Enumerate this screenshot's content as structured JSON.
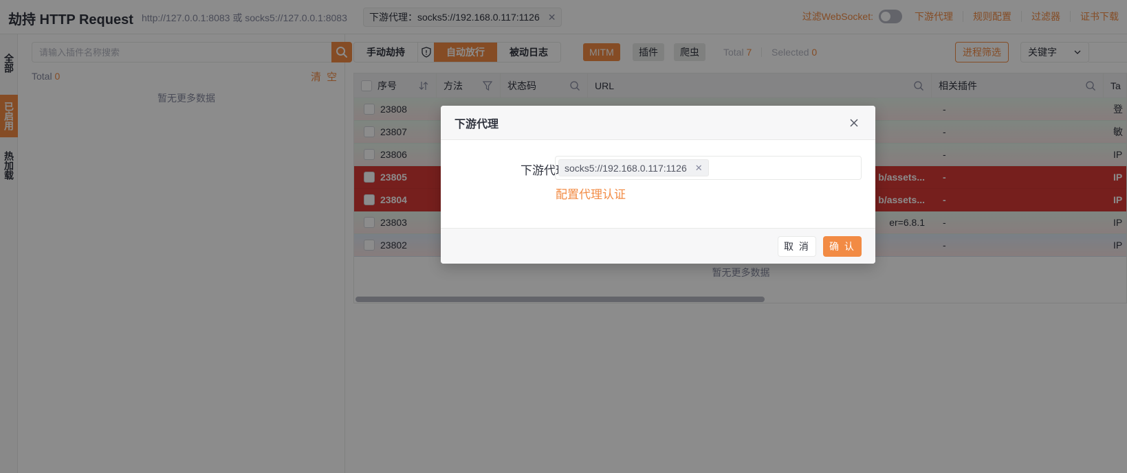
{
  "header": {
    "title": "劫持 HTTP Request",
    "listen": "http://127.0.0.1:8083 或 socks5://127.0.0.1:8083",
    "proxy_tag": "下游代理：socks5://192.168.0.117:1126",
    "filter_ws_label": "过滤WebSocket:",
    "links": [
      "下游代理",
      "规则配置",
      "过滤器",
      "证书下载"
    ]
  },
  "vtabs": [
    "全部",
    "已启用",
    "热加载"
  ],
  "plugin_panel": {
    "search_placeholder": "请输入插件名称搜索",
    "total_label": "Total",
    "total_value": "0",
    "clear_label": "清 空",
    "empty_text": "暂无更多数据"
  },
  "toolbar": {
    "manual": "手动劫持",
    "auto": "自动放行",
    "passive": "被动日志",
    "tags": [
      "MITM",
      "插件",
      "爬虫"
    ],
    "total_label": "Total",
    "total_value": "7",
    "selected_label": "Selected",
    "selected_value": "0",
    "process_filter": "进程筛选",
    "keyword": "关键字"
  },
  "table": {
    "headers": [
      "序号",
      "方法",
      "状态码",
      "URL",
      "相关插件",
      "Ta"
    ],
    "rows": [
      {
        "id": "23808",
        "url": "",
        "plugin": "-",
        "tag": "登",
        "style": "green"
      },
      {
        "id": "23807",
        "url": "",
        "plugin": "-",
        "tag": "敏",
        "style": "green"
      },
      {
        "id": "23806",
        "url": "",
        "plugin": "-",
        "tag": "IP",
        "style": "green"
      },
      {
        "id": "23805",
        "url": "b/assets...",
        "plugin": "-",
        "tag": "IP",
        "style": "red"
      },
      {
        "id": "23804",
        "url": "b/assets...",
        "plugin": "-",
        "tag": "IP",
        "style": "red"
      },
      {
        "id": "23803",
        "url": "er=6.8.1",
        "plugin": "-",
        "tag": "IP",
        "style": "green"
      },
      {
        "id": "23802",
        "url": "",
        "plugin": "-",
        "tag": "IP",
        "style": "blue"
      }
    ],
    "empty_text": "暂无更多数据"
  },
  "modal": {
    "title": "下游代理",
    "field_label": "下游代理",
    "chip": "socks5://192.168.0.117:1126",
    "auth_link": "配置代理认证",
    "cancel": "取 消",
    "ok": "确 认"
  },
  "colors": {
    "accent": "#f28b44",
    "danger_row": "#d83a36",
    "text": "#31343f",
    "muted": "#85899e"
  }
}
